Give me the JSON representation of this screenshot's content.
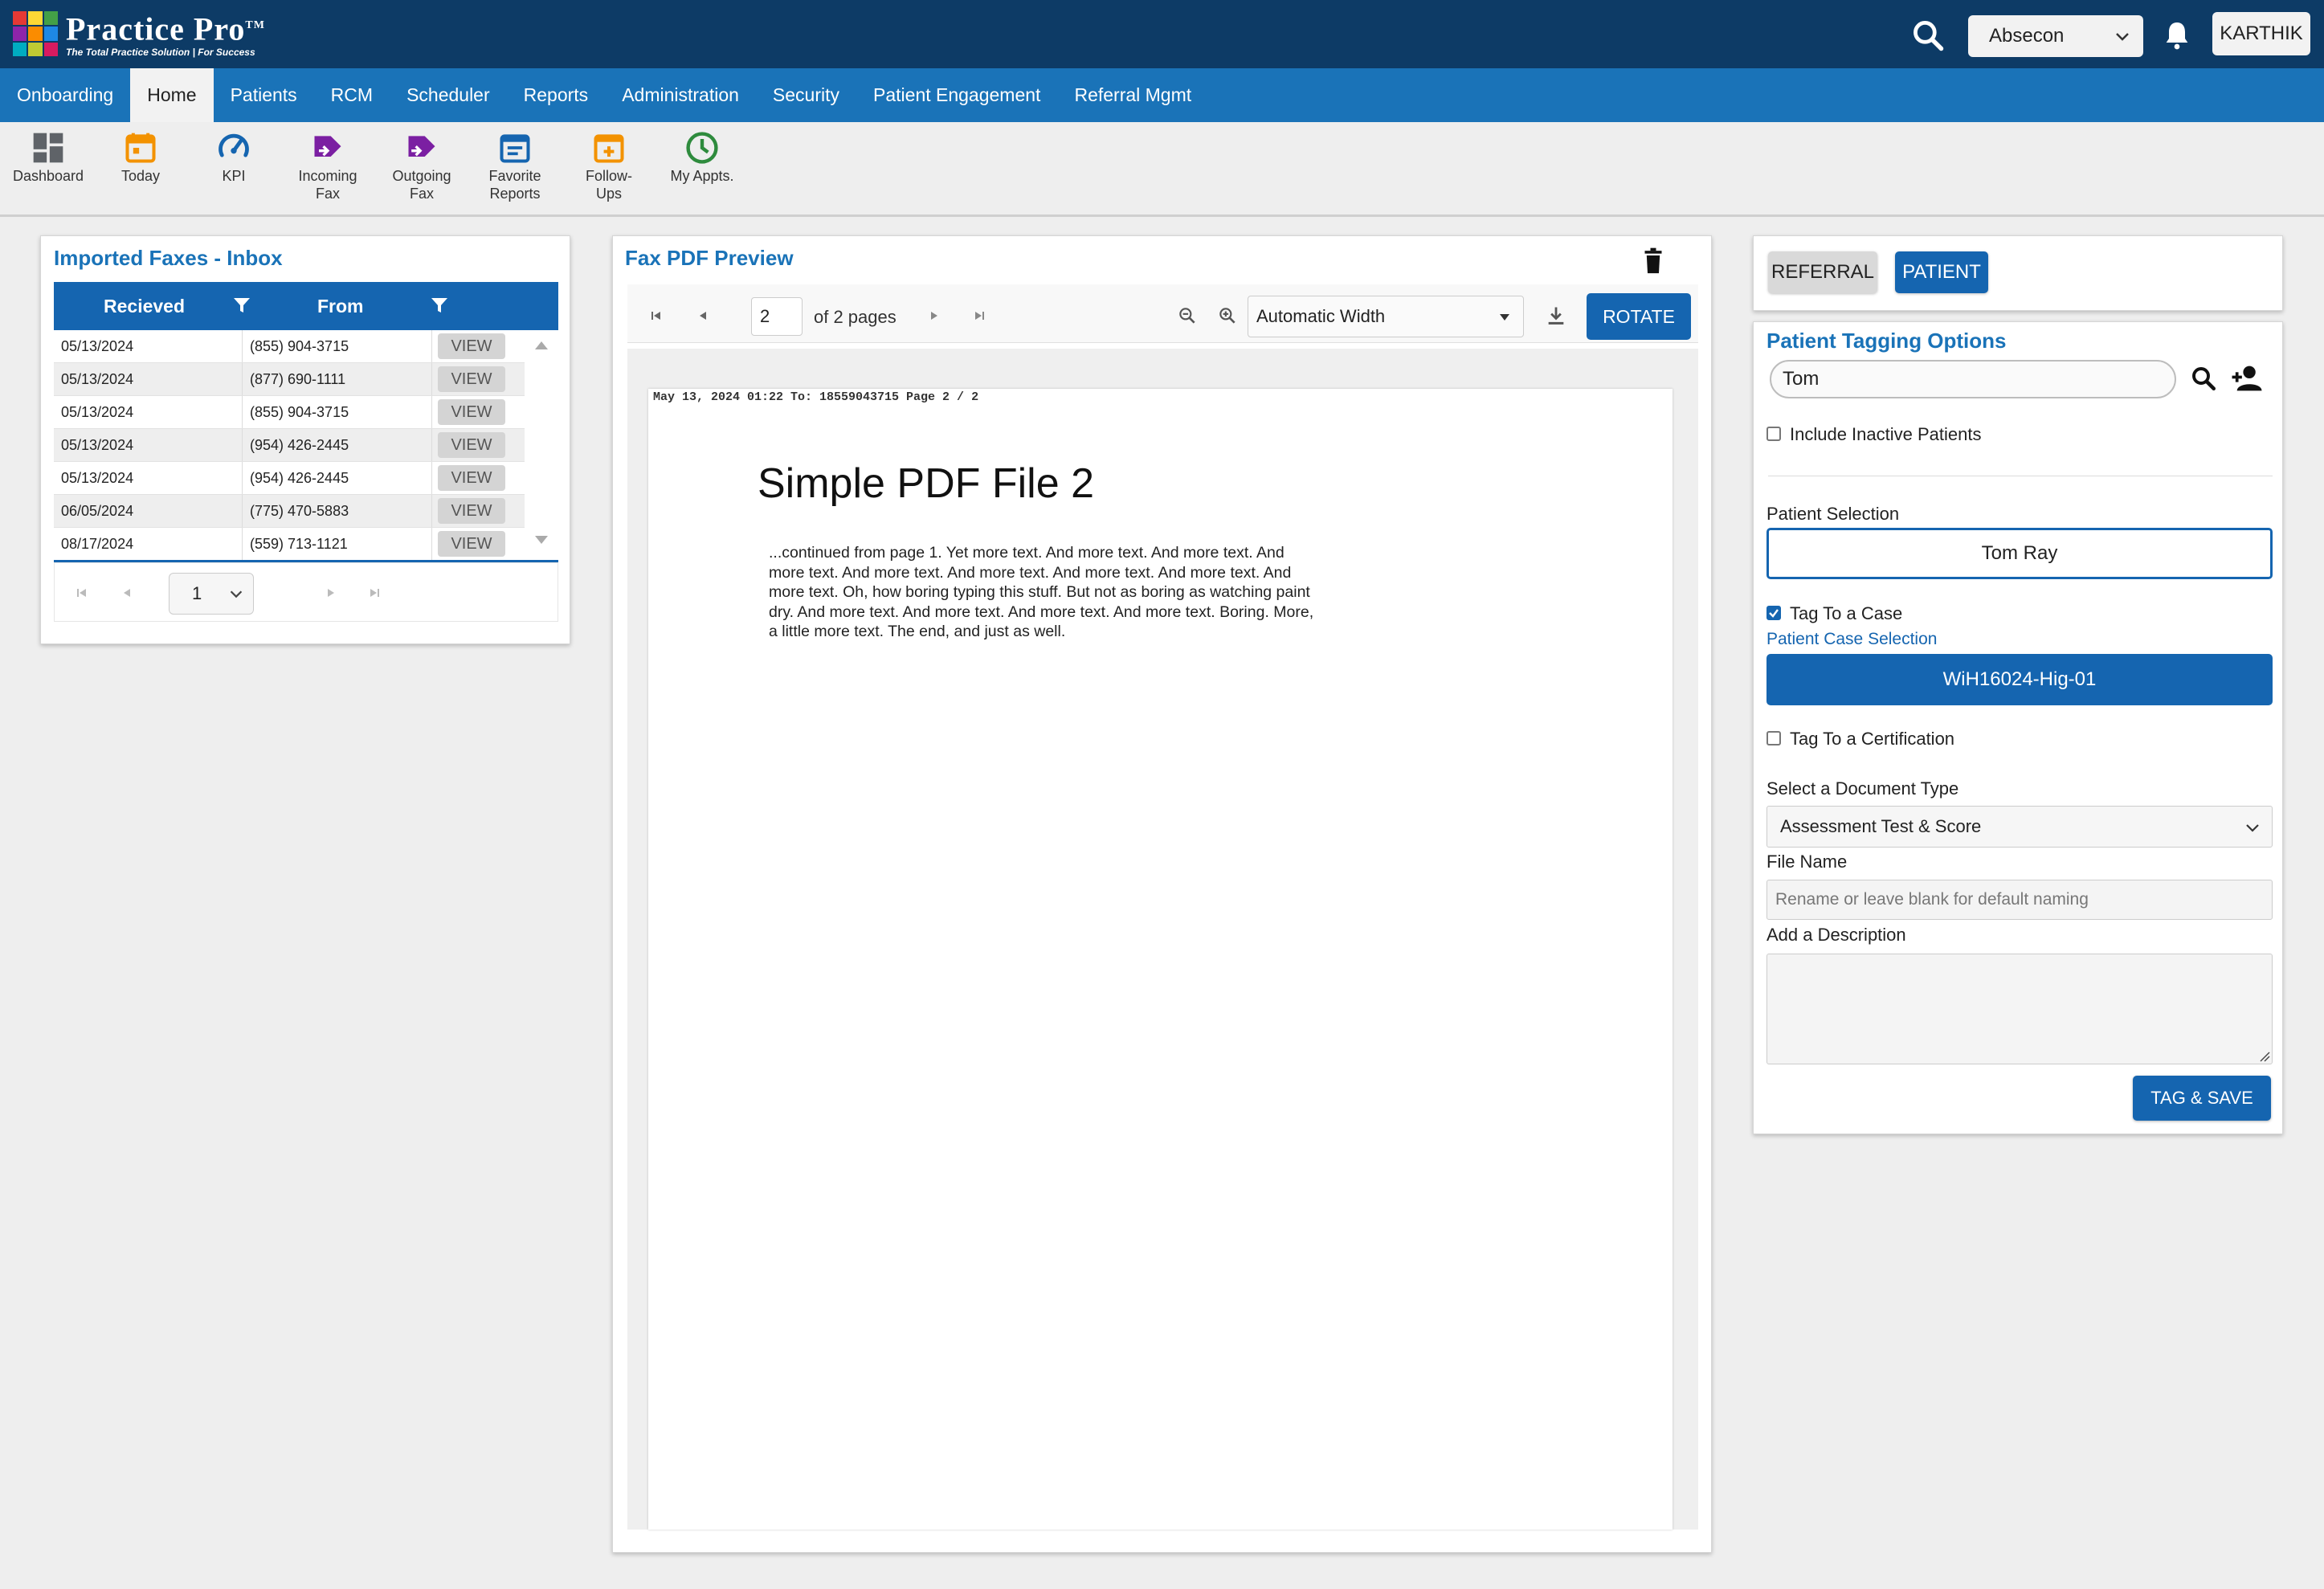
{
  "app": {
    "logo_title": "Practice Pro",
    "logo_tm": "TM",
    "logo_sub": "The Total Practice Solution | For Success",
    "location": "Absecon",
    "user": "KARTHIK"
  },
  "nav": {
    "items": [
      {
        "label": "Onboarding"
      },
      {
        "label": "Home"
      },
      {
        "label": "Patients"
      },
      {
        "label": "RCM"
      },
      {
        "label": "Scheduler"
      },
      {
        "label": "Reports"
      },
      {
        "label": "Administration"
      },
      {
        "label": "Security"
      },
      {
        "label": "Patient Engagement"
      },
      {
        "label": "Referral Mgmt"
      }
    ],
    "active": "Home"
  },
  "toolbar": {
    "dashboard": "Dashboard",
    "today": "Today",
    "kpi": "KPI",
    "incoming_fax_1": "Incoming",
    "incoming_fax_2": "Fax",
    "outgoing_fax_1": "Outgoing",
    "outgoing_fax_2": "Fax",
    "favorite_reports_1": "Favorite",
    "favorite_reports_2": "Reports",
    "follow_ups_1": "Follow-",
    "follow_ups_2": "Ups",
    "my_appts": "My Appts."
  },
  "inbox": {
    "title": "Imported Faxes - Inbox",
    "col_received": "Recieved",
    "col_from": "From",
    "view_label": "VIEW",
    "rows": [
      {
        "date": "05/13/2024",
        "from": "(855) 904-3715"
      },
      {
        "date": "05/13/2024",
        "from": "(877) 690-1111"
      },
      {
        "date": "05/13/2024",
        "from": "(855) 904-3715"
      },
      {
        "date": "05/13/2024",
        "from": "(954) 426-2445"
      },
      {
        "date": "05/13/2024",
        "from": "(954) 426-2445"
      },
      {
        "date": "06/05/2024",
        "from": "(775) 470-5883"
      },
      {
        "date": "08/17/2024",
        "from": "(559) 713-1121"
      }
    ],
    "page": "1"
  },
  "preview": {
    "title": "Fax PDF Preview",
    "page_number": "2",
    "of_pages": "of 2 pages",
    "zoom": "Automatic Width",
    "rotate_label": "ROTATE",
    "pdf_header": "May 13, 2024 01:22 To: 18559043715 Page 2 / 2",
    "pdf_title": "Simple PDF File 2",
    "pdf_body": "...continued from page 1. Yet more text. And more text. And more text. And more text. And more text. And more text. And more text. And more text. And more text. Oh, how boring typing this stuff. But not as boring as watching paint dry. And more text. And more text. And more text. And more text. Boring.  More, a little more text. The end, and just as well."
  },
  "tabs": {
    "referral": "REFERRAL",
    "patient": "PATIENT"
  },
  "tagging": {
    "title": "Patient Tagging Options",
    "search_value": "Tom",
    "include_inactive": "Include Inactive Patients",
    "include_inactive_checked": false,
    "patient_selection_label": "Patient Selection",
    "patient_selected": "Tom Ray",
    "tag_case_label": "Tag To a Case",
    "tag_case_checked": true,
    "case_selection_label": "Patient Case Selection",
    "case_selected": "WiH16024-Hig-01",
    "tag_cert_label": "Tag To a Certification",
    "tag_cert_checked": false,
    "doc_type_label": "Select a Document Type",
    "doc_type_value": "Assessment Test & Score",
    "file_name_label": "File Name",
    "file_name_placeholder": "Rename or leave blank for default naming",
    "description_label": "Add a Description",
    "save_label": "TAG & SAVE"
  },
  "colors": {
    "header": "#0d3b66",
    "nav": "#1a73b8",
    "accent": "#1565b0",
    "purple_icon": "#7b1fa2",
    "orange_icon": "#f39200",
    "green_icon": "#2e8b3d"
  }
}
